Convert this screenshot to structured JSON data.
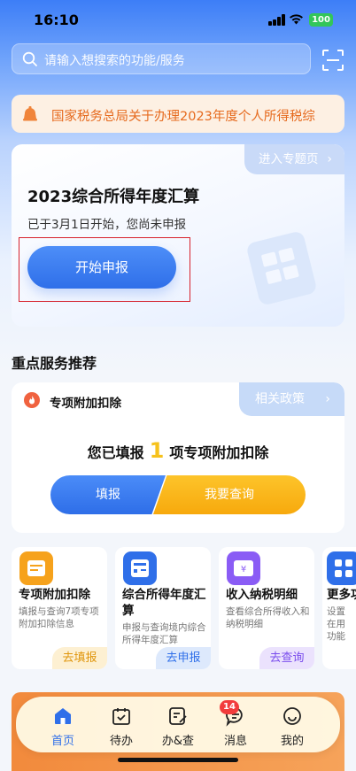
{
  "status_bar": {
    "time": "16:10",
    "battery": "100"
  },
  "search": {
    "placeholder": "请输入想搜索的功能/服务"
  },
  "notice": {
    "text": "国家税务总局关于办理2023年度个人所得税综"
  },
  "annual_card": {
    "topic_link": "进入专题页",
    "title": "2023综合所得年度汇算",
    "subtitle": "已于3月1日开始，您尚未申报",
    "start_button": "开始申报"
  },
  "section": {
    "title": "重点服务推荐"
  },
  "deduction_card": {
    "label": "专项附加扣除",
    "policy_link": "相关政策",
    "filled_prefix": "您已填报",
    "filled_count": "1",
    "filled_suffix": "项专项附加扣除",
    "fill_button": "填报",
    "query_button": "我要查询"
  },
  "services": [
    {
      "title": "专项附加扣除",
      "desc": "填报与查询7项专项附加扣除信息",
      "action": "去填报",
      "color": "#f6a21c"
    },
    {
      "title": "综合所得年度汇算",
      "desc": "申报与查询境内综合所得年度汇算",
      "action": "去申报",
      "color": "#2f6fe9"
    },
    {
      "title": "收入纳税明细",
      "desc": "查看综合所得收入和纳税明细",
      "action": "去查询",
      "color": "#8a5cf5"
    },
    {
      "title": "更多功",
      "desc": "设置在用功能",
      "action": "",
      "color": "#2f6fe9"
    }
  ],
  "tabbar": {
    "items": [
      {
        "label": "首页"
      },
      {
        "label": "待办"
      },
      {
        "label": "办&查"
      },
      {
        "label": "消息"
      },
      {
        "label": "我的"
      }
    ],
    "messages_badge": "14"
  }
}
